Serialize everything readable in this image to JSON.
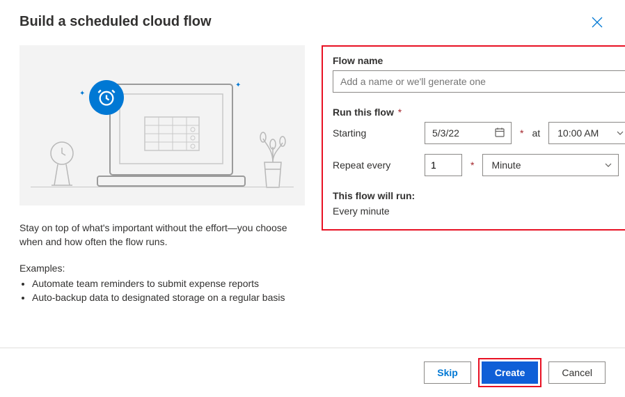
{
  "dialog": {
    "title": "Build a scheduled cloud flow"
  },
  "left": {
    "description": "Stay on top of what's important without the effort—you choose when and how often the flow runs.",
    "examples_label": "Examples:",
    "examples": [
      "Automate team reminders to submit expense reports",
      "Auto-backup data to designated storage on a regular basis"
    ]
  },
  "form": {
    "flow_name_label": "Flow name",
    "flow_name_placeholder": "Add a name or we'll generate one",
    "run_label": "Run this flow",
    "starting_label": "Starting",
    "starting_date": "5/3/22",
    "at_label": "at",
    "starting_time": "10:00 AM",
    "repeat_label": "Repeat every",
    "repeat_value": "1",
    "repeat_unit": "Minute",
    "summary_label": "This flow will run:",
    "summary_text": "Every minute"
  },
  "footer": {
    "skip": "Skip",
    "create": "Create",
    "cancel": "Cancel"
  }
}
